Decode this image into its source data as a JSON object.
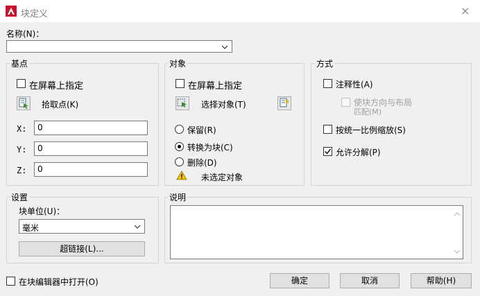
{
  "window": {
    "title": "块定义",
    "close_label": "×"
  },
  "name": {
    "label": "名称(N)：",
    "value": ""
  },
  "base_point": {
    "title": "基点",
    "specify_on_screen": {
      "label": "在屏幕上指定",
      "checked": false
    },
    "pick_point_label": "拾取点(K)",
    "x_label": "X:",
    "x_value": "0",
    "y_label": "Y:",
    "y_value": "0",
    "z_label": "Z:",
    "z_value": "0"
  },
  "objects": {
    "title": "对象",
    "specify_on_screen": {
      "label": "在屏幕上指定",
      "checked": false
    },
    "select_objects_label": "选择对象(T)",
    "retain_label": "保留(R)",
    "convert_label": "转换为块(C)",
    "delete_label": "删除(D)",
    "selected_option": "convert",
    "status_text": "未选定对象"
  },
  "behavior": {
    "title": "方式",
    "annotative": {
      "label": "注释性(A)",
      "checked": false
    },
    "match_orientation": {
      "label_line1": "使块方向与布局",
      "label_line2": "匹配(M)",
      "checked": false,
      "disabled": true
    },
    "scale_uniformly": {
      "label": "按统一比例缩放(S)",
      "checked": false
    },
    "allow_exploding": {
      "label": "允许分解(P)",
      "checked": true
    }
  },
  "settings": {
    "title": "设置",
    "block_unit_label": "块单位(U)：",
    "block_unit_value": "毫米",
    "hyperlink_label": "超链接(L)..."
  },
  "description": {
    "title": "说明",
    "value": ""
  },
  "footer": {
    "open_in_editor": {
      "label": "在块编辑器中打开(O)",
      "checked": false
    },
    "ok_label": "确定",
    "cancel_label": "取消",
    "help_label": "帮助(H)"
  }
}
